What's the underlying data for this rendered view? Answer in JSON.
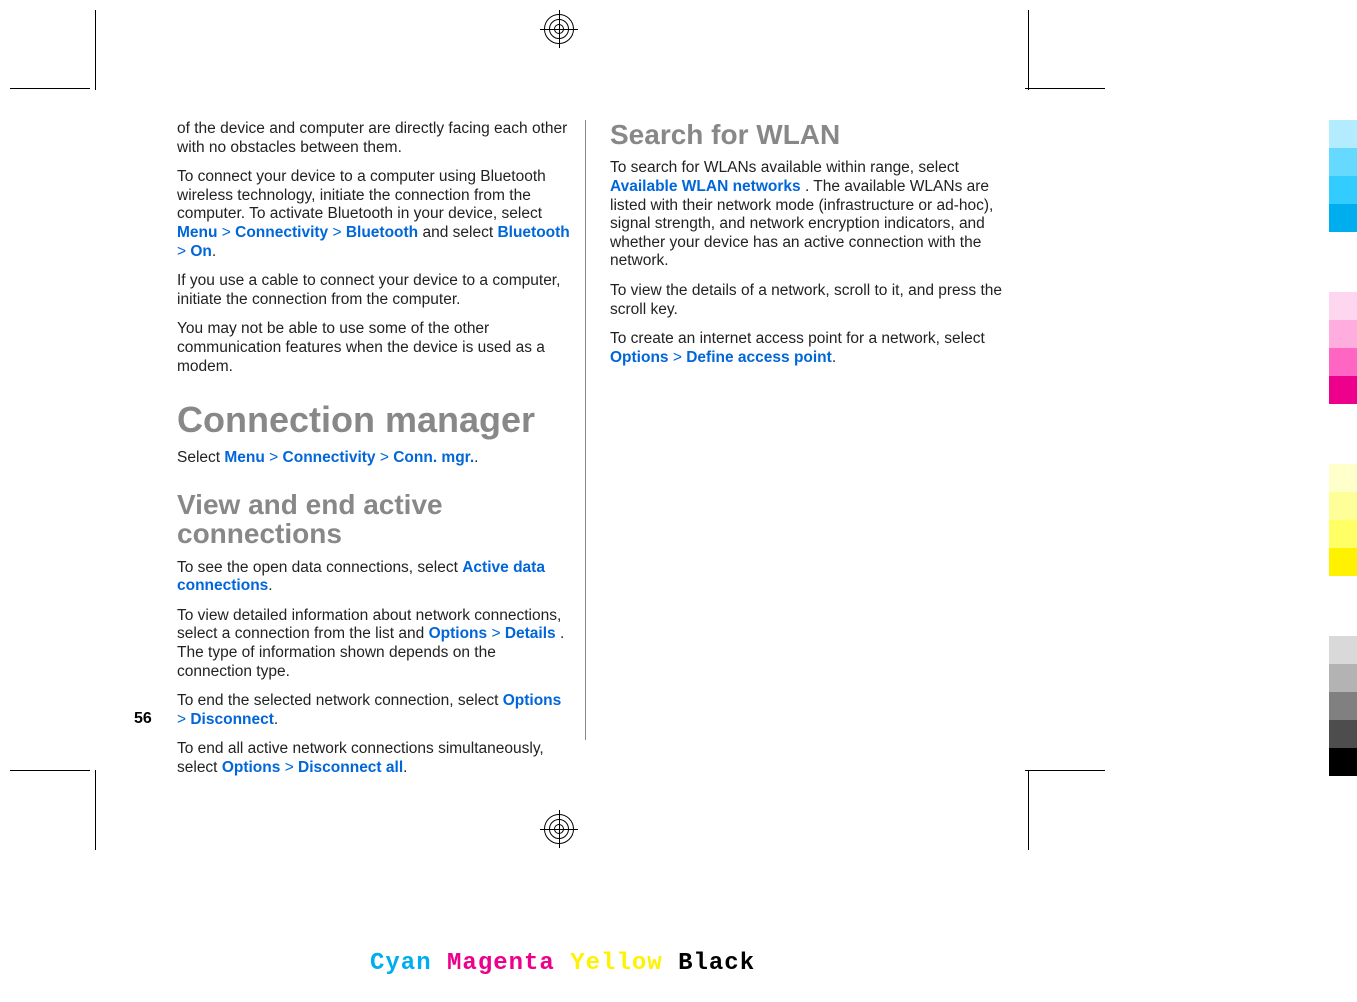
{
  "page_number": "56",
  "col1": {
    "p1": "of the device and computer are directly facing each other with no obstacles between them.",
    "p2a": "To connect your device to a computer using Bluetooth wireless technology, initiate the connection from the computer. To activate Bluetooth in your device, select ",
    "p2_menu": "Menu",
    "p2_conn": "Connectivity",
    "p2_bt": "Bluetooth",
    "p2b": " and select ",
    "p2_bt2": "Bluetooth",
    "p2_on": "On",
    "p3": "If you use a cable to connect your device to a computer, initiate the connection from the computer.",
    "p4": "You may not be able to use some of the other communication features when the device is used as a modem.",
    "h1": "Connection manager",
    "p5a": "Select ",
    "p5_menu": "Menu",
    "p5_conn": "Connectivity",
    "p5_mgr": "Conn. mgr.",
    "h2": "View and end active connections",
    "p6a": "To see the open data connections, select ",
    "p6_link": "Active data connections",
    "p7a": "To view detailed information about network connections, select a connection from the list and ",
    "p7_opt": "Options",
    "p7_det": "Details",
    "p7b": ". The type of information shown depends on the connection type.",
    "p8a": "To end the selected network connection, select ",
    "p8_opt": "Options",
    "p8_disc": "Disconnect",
    "p9a": "To end all active network connections simultaneously, select ",
    "p9_opt": "Options",
    "p9_disc": "Disconnect all"
  },
  "col2": {
    "h2": "Search for WLAN",
    "p1a": "To search for WLANs available within range, select ",
    "p1_link": "Available WLAN networks",
    "p1b": ". The available WLANs are listed with their network mode (infrastructure or ad-hoc), signal strength, and network encryption indicators, and whether your device has an active connection with the network.",
    "p2": "To view the details of a network, scroll to it, and press the scroll key.",
    "p3a": "To create an internet access point for a network, select ",
    "p3_opt": "Options",
    "p3_def": "Define access point"
  },
  "gt": ">",
  "dot": ".",
  "footer": {
    "c": "Cyan",
    "m": "Magenta",
    "y": "Yellow",
    "k": "Black"
  },
  "colors": {
    "cyan_set": [
      "#b3ecff",
      "#66d9ff",
      "#33ccff",
      "#00aeef"
    ],
    "mag_set": [
      "#ffd6f0",
      "#ffadde",
      "#ff66c4",
      "#ec008c"
    ],
    "yel_set": [
      "#ffffcc",
      "#ffff99",
      "#ffff66",
      "#fff200"
    ],
    "bk_set": [
      "#d9d9d9",
      "#b3b3b3",
      "#808080",
      "#4d4d4d",
      "#000000"
    ]
  }
}
